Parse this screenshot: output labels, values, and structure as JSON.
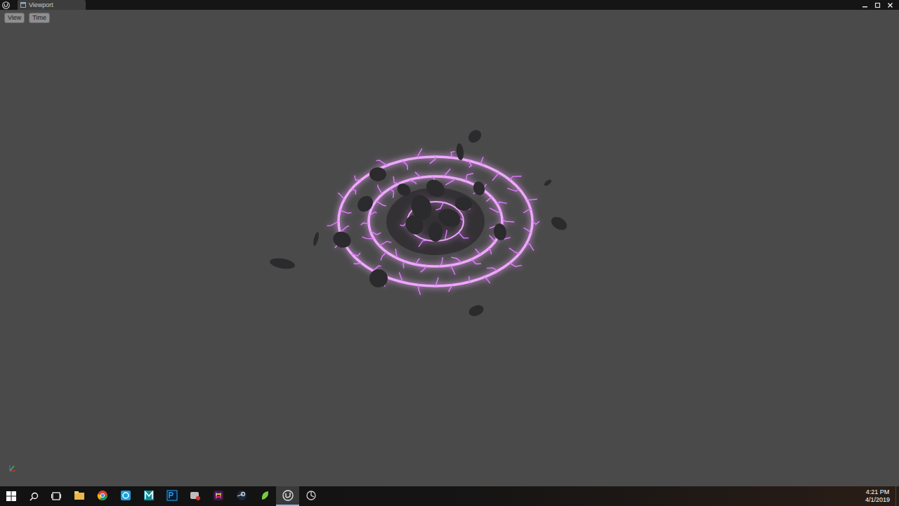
{
  "window": {
    "tab": "Viewport"
  },
  "toolbar": {
    "buttons": [
      "View",
      "Time"
    ]
  },
  "taskbar": {
    "apps": [
      {
        "kind": "explorer",
        "selected": false
      },
      {
        "kind": "chrome",
        "selected": false
      },
      {
        "kind": "tool",
        "selected": false
      },
      {
        "kind": "maya",
        "selected": false
      },
      {
        "kind": "photoshop",
        "selected": false
      },
      {
        "kind": "messenger",
        "selected": false
      },
      {
        "kind": "slack",
        "selected": false
      },
      {
        "kind": "steam",
        "selected": false
      },
      {
        "kind": "leaf",
        "selected": false
      },
      {
        "kind": "unreal",
        "selected": true
      },
      {
        "kind": "circle",
        "selected": false
      }
    ],
    "clock": {
      "time": "4:21 PM",
      "date": "4/1/2019"
    }
  }
}
